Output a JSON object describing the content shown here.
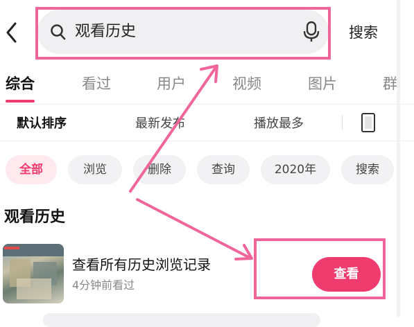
{
  "search": {
    "query": "观看历史",
    "button_label": "搜索"
  },
  "tabs": [
    {
      "label": "综合",
      "active": true
    },
    {
      "label": "看过"
    },
    {
      "label": "用户"
    },
    {
      "label": "视频"
    },
    {
      "label": "图片"
    },
    {
      "label": "群"
    }
  ],
  "sort_options": [
    {
      "label": "默认排序",
      "active": true
    },
    {
      "label": "最新发布"
    },
    {
      "label": "播放最多"
    }
  ],
  "filter_chips": [
    {
      "label": "全部",
      "active": true
    },
    {
      "label": "浏览"
    },
    {
      "label": "删除"
    },
    {
      "label": "查询"
    },
    {
      "label": "2020年"
    },
    {
      "label": "搜索"
    }
  ],
  "section": {
    "title": "观看历史"
  },
  "result": {
    "title": "查看所有历史浏览记录",
    "subtitle": "4分钟前看过",
    "action_label": "查看"
  },
  "colors": {
    "accent": "#ee3c6e",
    "annotation": "#f0669a"
  },
  "icons": [
    "back-icon",
    "search-icon",
    "mic-icon",
    "layout-icon"
  ]
}
